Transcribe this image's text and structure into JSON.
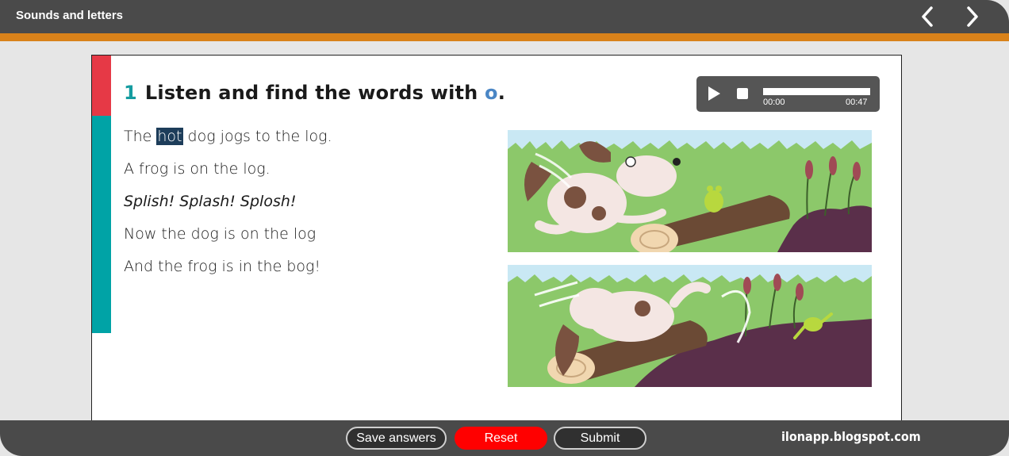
{
  "header": {
    "title": "Sounds and letters"
  },
  "icons": {
    "prev": "chevron-left-icon",
    "next": "chevron-right-icon",
    "play": "play-icon",
    "stop": "stop-icon"
  },
  "exercise": {
    "number": "1",
    "instruction": "Listen and find the words with",
    "target_letter": "o",
    "instruction_end": "."
  },
  "audio": {
    "current_time": "00:00",
    "total_time": "00:47"
  },
  "poem": {
    "line1_before": "The ",
    "line1_highlight": "hot",
    "line1_after": " dog jogs to the log.",
    "line2": "A frog is on the log.",
    "line3": "Splish! Splash! Splosh!",
    "line4": "Now the dog is on the log",
    "line5": "And the frog is in the bog!"
  },
  "footer": {
    "save_label": "Save answers",
    "reset_label": "Reset",
    "submit_label": "Submit",
    "watermark": "ilonapp.blogspot.com"
  },
  "colors": {
    "topbar": "#4a4a4a",
    "orange_strip": "#d9821a",
    "accent_red": "#e63946",
    "accent_teal": "#00a3a6",
    "highlight": "#1d3d5a",
    "reset_button": "#ff0000"
  }
}
